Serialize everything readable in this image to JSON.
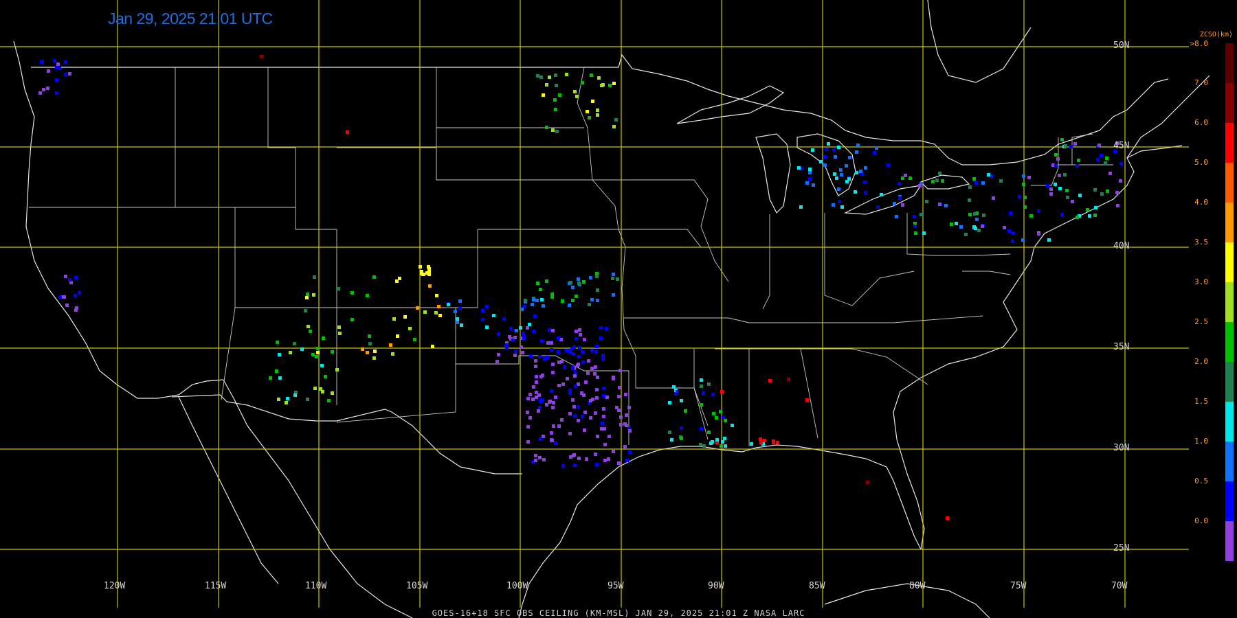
{
  "timestamp": "Jan 29, 2025 21:01 UTC",
  "footer": "GOES-16+18  SFC OBS CEILING (KM-MSL)   JAN 29, 2025 21:01 Z   NASA LARC",
  "lon_labels": [
    "120W",
    "115W",
    "110W",
    "105W",
    "100W",
    "95W",
    "90W",
    "85W",
    "80W",
    "75W",
    "70W"
  ],
  "lat_labels": [
    "50N",
    "45N",
    "40N",
    "35N",
    "30N",
    "25N"
  ],
  "legend": {
    "title": "ZCSO(km)",
    "top_label": ">8.0",
    "ticks": [
      "7.0",
      "6.0",
      "5.0",
      "4.0",
      "3.5",
      "3.0",
      "2.5",
      "2.0",
      "1.5",
      "1.0",
      "0.5",
      "0.0"
    ],
    "colors": [
      "#5a0000",
      "#8a0000",
      "#ff0000",
      "#ff5a00",
      "#ff9a00",
      "#ffff00",
      "#a0e020",
      "#00c000",
      "#208050",
      "#00e8e8",
      "#1070ff",
      "#0000ff",
      "#9040e0"
    ]
  },
  "colors": {
    "grid": "#c8c800",
    "coast": "#e8e8e8",
    "purple": "#9040e0",
    "blue": "#0000ff",
    "ltblue": "#1070ff",
    "cyan": "#00e8e8",
    "dkgreen": "#208050",
    "green": "#00c000",
    "ltgreen": "#a0e020",
    "yellow": "#ffff00",
    "orange": "#ff9a00",
    "red": "#ff0000",
    "dkred": "#8a0000"
  }
}
